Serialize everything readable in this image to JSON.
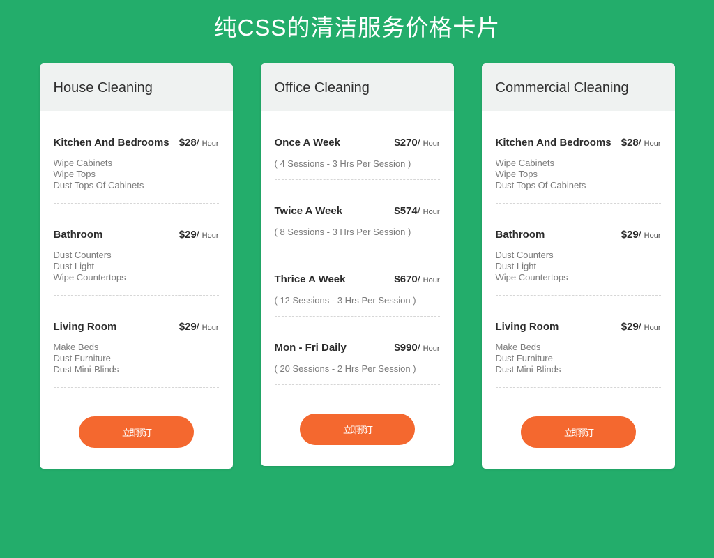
{
  "page": {
    "title": "纯CSS的清洁服务价格卡片",
    "background_color": "#23ad6b",
    "accent_color": "#f4682f",
    "header_bg_color": "#eff2f1"
  },
  "cards": [
    {
      "id": "house-cleaning",
      "title": "House Cleaning",
      "button_label": "立即预订",
      "plans": [
        {
          "name": "Kitchen And Bedrooms",
          "price": "$28",
          "per": "/",
          "unit": "Hour",
          "features": [
            "Wipe Cabinets",
            "Wipe Tops",
            "Dust Tops Of Cabinets"
          ]
        },
        {
          "name": "Bathroom",
          "price": "$29",
          "per": "/",
          "unit": "Hour",
          "features": [
            "Dust Counters",
            "Dust Light",
            "Wipe Countertops"
          ]
        },
        {
          "name": "Living Room",
          "price": "$29",
          "per": "/",
          "unit": "Hour",
          "features": [
            "Make Beds",
            "Dust Furniture",
            "Dust Mini-Blinds"
          ]
        }
      ]
    },
    {
      "id": "office-cleaning",
      "title": "Office Cleaning",
      "button_label": "立即预订",
      "plans": [
        {
          "name": "Once A Week",
          "price": "$270",
          "per": "/",
          "unit": "Hour",
          "note": "( 4 Sessions - 3 Hrs Per Session )"
        },
        {
          "name": "Twice A Week",
          "price": "$574",
          "per": "/",
          "unit": "Hour",
          "note": "( 8 Sessions - 3 Hrs Per Session )"
        },
        {
          "name": "Thrice A Week",
          "price": "$670",
          "per": "/",
          "unit": "Hour",
          "note": "( 12 Sessions - 3 Hrs Per Session )"
        },
        {
          "name": "Mon - Fri Daily",
          "price": "$990",
          "per": "/",
          "unit": "Hour",
          "note": "( 20 Sessions - 2 Hrs Per Session )"
        }
      ]
    },
    {
      "id": "commercial-cleaning",
      "title": "Commercial Cleaning",
      "button_label": "立即预订",
      "plans": [
        {
          "name": "Kitchen And Bedrooms",
          "price": "$28",
          "per": "/",
          "unit": "Hour",
          "features": [
            "Wipe Cabinets",
            "Wipe Tops",
            "Dust Tops Of Cabinets"
          ]
        },
        {
          "name": "Bathroom",
          "price": "$29",
          "per": "/",
          "unit": "Hour",
          "features": [
            "Dust Counters",
            "Dust Light",
            "Wipe Countertops"
          ]
        },
        {
          "name": "Living Room",
          "price": "$29",
          "per": "/",
          "unit": "Hour",
          "features": [
            "Make Beds",
            "Dust Furniture",
            "Dust Mini-Blinds"
          ]
        }
      ]
    }
  ]
}
